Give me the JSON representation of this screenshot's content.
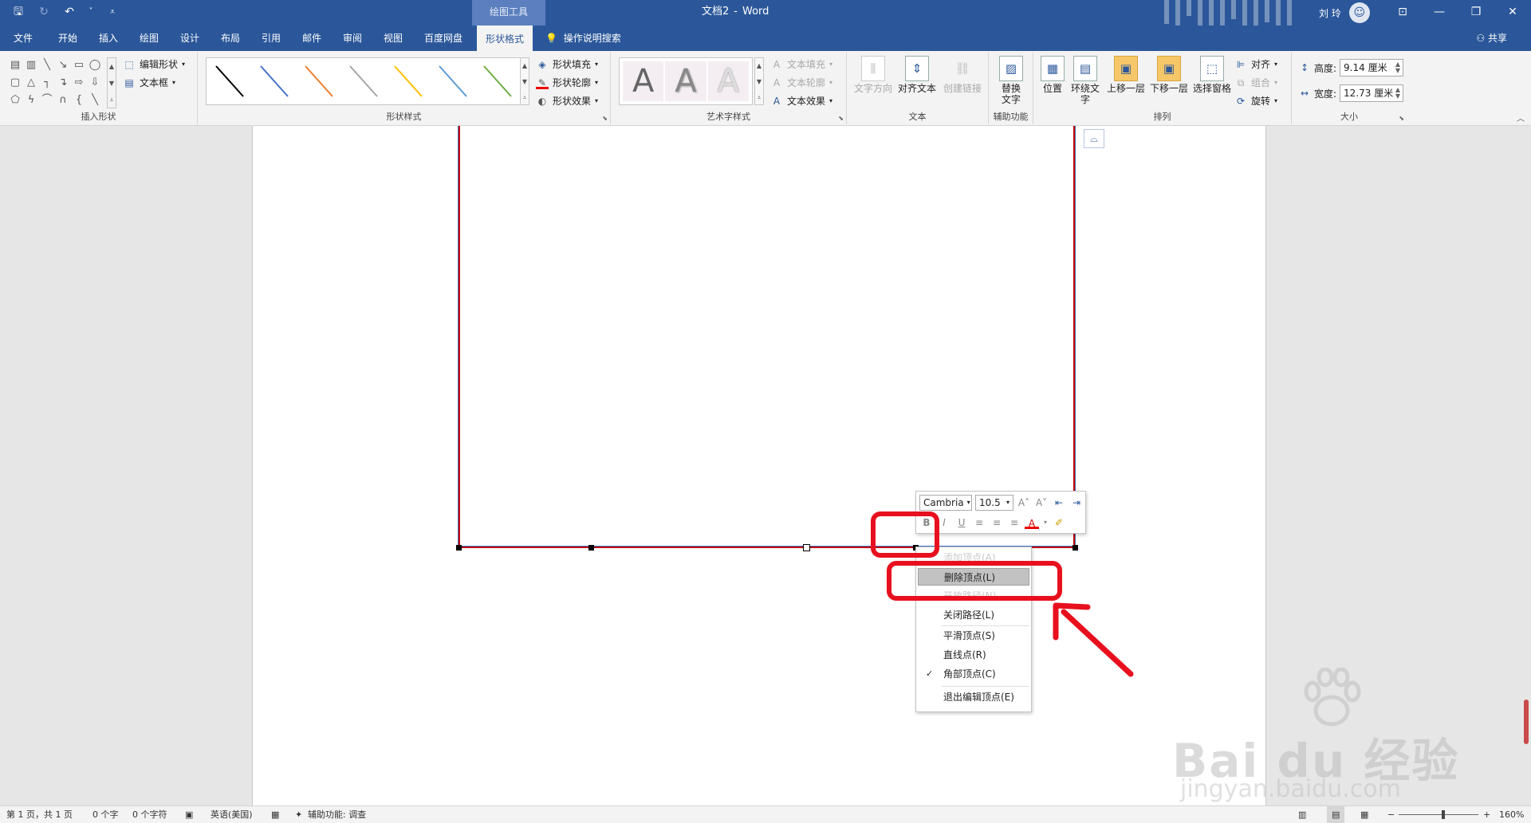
{
  "titlebar": {
    "context_tools": "绘图工具",
    "document": "文档2",
    "separator": "-",
    "app": "Word",
    "user": "刘 玲",
    "qat": {
      "save": "🖫",
      "redo": "↻",
      "undo": "↶",
      "undo_more": "˅",
      "customize": "⩡"
    },
    "window": {
      "ribbon_display": "⊡",
      "minimize": "—",
      "restore": "❐",
      "close": "✕"
    }
  },
  "tabs": [
    {
      "label": "文件"
    },
    {
      "label": "开始"
    },
    {
      "label": "插入"
    },
    {
      "label": "绘图"
    },
    {
      "label": "设计"
    },
    {
      "label": "布局"
    },
    {
      "label": "引用"
    },
    {
      "label": "邮件"
    },
    {
      "label": "审阅"
    },
    {
      "label": "视图"
    },
    {
      "label": "百度网盘"
    },
    {
      "label": "形状格式"
    }
  ],
  "tell_me": "操作说明搜索",
  "share": "共享",
  "ribbon": {
    "insert_shapes": {
      "label": "插入形状",
      "edit_shape": "编辑形状",
      "textbox": "文本框"
    },
    "shape_styles": {
      "label": "形状样式",
      "fill": "形状填充",
      "outline": "形状轮廓",
      "effects": "形状效果"
    },
    "wordart": {
      "label": "艺术字样式",
      "letter": "A",
      "text_fill": "文本填充",
      "text_outline": "文本轮廓",
      "text_effects": "文本效果"
    },
    "text": {
      "label": "文本",
      "direction": "文字方向",
      "align": "对齐文本",
      "link": "创建链接"
    },
    "accessibility": {
      "label": "辅助功能",
      "alt_text": "替换文字"
    },
    "arrange": {
      "label": "排列",
      "position": "位置",
      "wrap": "环绕文字",
      "forward": "上移一层",
      "backward": "下移一层",
      "pane": "选择窗格",
      "align": "对齐",
      "group": "组合",
      "rotate": "旋转"
    },
    "size": {
      "label": "大小",
      "height_label": "高度:",
      "height": "9.14 厘米",
      "width_label": "宽度:",
      "width": "12.73 厘米"
    }
  },
  "mini_toolbar": {
    "font": "Cambria",
    "size": "10.5"
  },
  "context_menu": {
    "items": [
      {
        "label": "添加顶点(A)"
      },
      {
        "label": "删除顶点(L)"
      },
      {
        "label": "开放路径(N)"
      },
      {
        "label": "关闭路径(L)"
      },
      {
        "label": "平滑顶点(S)"
      },
      {
        "label": "直线点(R)"
      },
      {
        "label": "角部顶点(C)",
        "checked": true
      },
      {
        "label": "退出编辑顶点(E)"
      }
    ]
  },
  "watermark": {
    "brand": "Bai du 经验",
    "url": "jingyan.baidu.com"
  },
  "statusbar": {
    "page": "第 1 页，共 1 页",
    "words": "0 个字",
    "chars": "0 个字符",
    "language": "英语(美国)",
    "accessibility": "辅助功能: 调查",
    "zoom": "160%"
  },
  "colors": {
    "brand": "#2b579a",
    "annotation": "#e8101e",
    "shape_outline": "#c00000"
  }
}
